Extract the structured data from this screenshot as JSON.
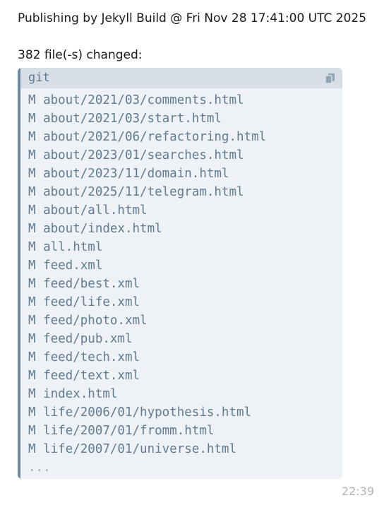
{
  "message": {
    "header": "Publishing by Jekyll Build @ Fri Nov 28 17:41:00 UTC 2025",
    "summary": "382 file(-s) changed:",
    "code_block": {
      "language": "git",
      "copy_icon": "copy-icon",
      "lines": [
        "M about/2021/03/comments.html",
        "M about/2021/03/start.html",
        "M about/2021/06/refactoring.html",
        "M about/2023/01/searches.html",
        "M about/2023/11/domain.html",
        "M about/2025/11/telegram.html",
        "M about/all.html",
        "M about/index.html",
        "M all.html",
        "M feed.xml",
        "M feed/best.xml",
        "M feed/life.xml",
        "M feed/photo.xml",
        "M feed/pub.xml",
        "M feed/tech.xml",
        "M feed/text.xml",
        "M index.html",
        "M life/2006/01/hypothesis.html",
        "M life/2007/01/fromm.html",
        "M life/2007/01/universe.html"
      ],
      "truncation": "..."
    },
    "time": "22:39"
  },
  "colors": {
    "code_background": "#eef1f5",
    "code_header": "#d7dee5",
    "accent": "#6b8aa3",
    "code_text": "#5f7c93",
    "timestamp": "#b0b5ba"
  }
}
